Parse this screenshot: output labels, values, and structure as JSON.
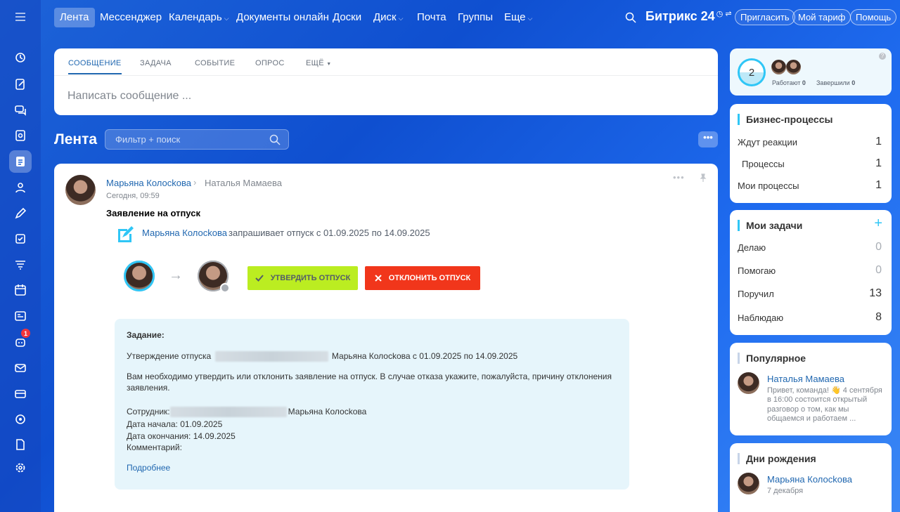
{
  "topnav": {
    "items": [
      {
        "label": "Лента"
      },
      {
        "label": "Мессенджер"
      },
      {
        "label": "Календарь"
      },
      {
        "label": "Документы онлайн"
      },
      {
        "label": "Доски"
      },
      {
        "label": "Диск"
      },
      {
        "label": "Почта"
      },
      {
        "label": "Группы"
      },
      {
        "label": "Еще"
      }
    ],
    "brand": "Битрикс 24",
    "invite": "Пригласить",
    "tariff": "Мой тариф",
    "help": "Помощь"
  },
  "sidebar": {
    "chat_badge": "1"
  },
  "composer": {
    "tabs": [
      "СООБЩЕНИЕ",
      "ЗАДАЧА",
      "СОБЫТИЕ",
      "ОПРОС",
      "ЕЩЁ"
    ],
    "placeholder": "Написать сообщение ..."
  },
  "feed": {
    "title": "Лента",
    "search_placeholder": "Фильтр + поиск",
    "more": "•••"
  },
  "post": {
    "author": "Марьяна Колосkова",
    "recipient": "Наталья Мамаева",
    "time": "Сегодня, 09:59",
    "title": "Заявление на отпуск",
    "request_author": "Марьяна Колосkова",
    "request_text": "запрашивает отпуск с 01.09.2025 по 14.09.2025",
    "approve": "УТВЕРДИТЬ ОТПУСК",
    "decline": "ОТКЛОНИТЬ ОТПУСК",
    "task": {
      "heading": "Задание:",
      "line1_prefix": "Утверждение отпуска",
      "line1_suffix": "Марьяна Колосkова с 01.09.2025 по 14.09.2025",
      "instruction_1": "Вам необходимо утвердить или отклонить заявление на отпуск. В случае отказа укажите, пожалуйста, причину отклонения",
      "instruction_2": "заявления.",
      "employee_label": "Сотрудник:",
      "employee_name": "Марьяна Колосkова",
      "start": "Дата начала: 01.09.2025",
      "end": "Дата окончания: 14.09.2025",
      "comment": "Комментарий:",
      "more": "Подробнее"
    }
  },
  "stats": {
    "count": "2",
    "working_label": "Работают",
    "working": "0",
    "done_label": "Завершили",
    "done": "0"
  },
  "bp": {
    "title": "Бизнес-процессы",
    "rows": [
      {
        "label": "Ждут реакции",
        "value": "1"
      },
      {
        "label": "Процессы",
        "value": "1"
      },
      {
        "label": "Мои процессы",
        "value": "1"
      }
    ]
  },
  "tasks": {
    "title": "Мои задачи",
    "rows": [
      {
        "label": "Делаю",
        "value": "0"
      },
      {
        "label": "Помогаю",
        "value": "0"
      },
      {
        "label": "Поручил",
        "value": "13"
      },
      {
        "label": "Наблюдаю",
        "value": "8"
      }
    ]
  },
  "popular": {
    "title": "Популярное",
    "author": "Наталья Мамаева",
    "text": [
      "Привет, команда! 👋 4 сентября",
      "в 16:00 состоится открытый",
      "разговор о том, как мы",
      "общаемся и работаем ..."
    ]
  },
  "birthdays": {
    "title": "Дни рождения",
    "name": "Марьяна Колосkова",
    "date": "7 декабря"
  }
}
